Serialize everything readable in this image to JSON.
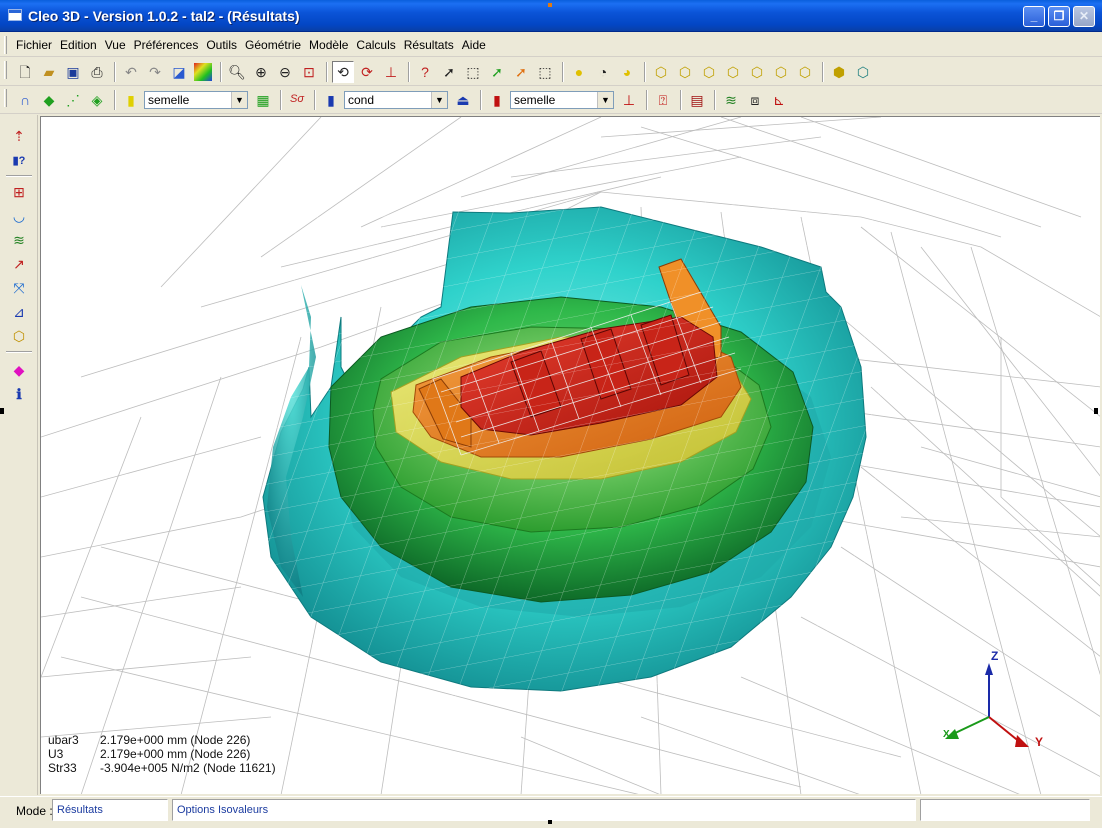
{
  "window": {
    "title": "Cleo 3D - Version 1.0.2 - tal2 - (Résultats)",
    "controls": {
      "minimize": "_",
      "maximize": "❐",
      "close": "✕"
    }
  },
  "menu": {
    "items": [
      "Fichier",
      "Edition",
      "Vue",
      "Préférences",
      "Outils",
      "Géométrie",
      "Modèle",
      "Calculs",
      "Résultats",
      "Aide"
    ]
  },
  "toolbar2": {
    "combo1_value": "semelle",
    "combo2_value": "cond",
    "combo3_value": "semelle",
    "sigma_label": "Sσ"
  },
  "viewport": {
    "readout": [
      {
        "name": "ubar3",
        "value": "2.179e+000 mm (Node 226)"
      },
      {
        "name": "U3",
        "value": "2.179e+000 mm (Node 226)"
      },
      {
        "name": "Str33",
        "value": "-3.904e+005 N/m2 (Node 11621)"
      }
    ],
    "axes": {
      "x": "X",
      "y": "Y",
      "z": "Z"
    },
    "colors": {
      "cyan": "#3fd6cf",
      "green": "#2fb84a",
      "yellow": "#e0d640",
      "orange": "#e0781e",
      "red": "#c81e14",
      "mesh": "#b8b8b8"
    }
  },
  "status": {
    "mode_label": "Mode :",
    "mode_value": "Résultats",
    "options": "Options Isovaleurs",
    "right_panel": ""
  }
}
